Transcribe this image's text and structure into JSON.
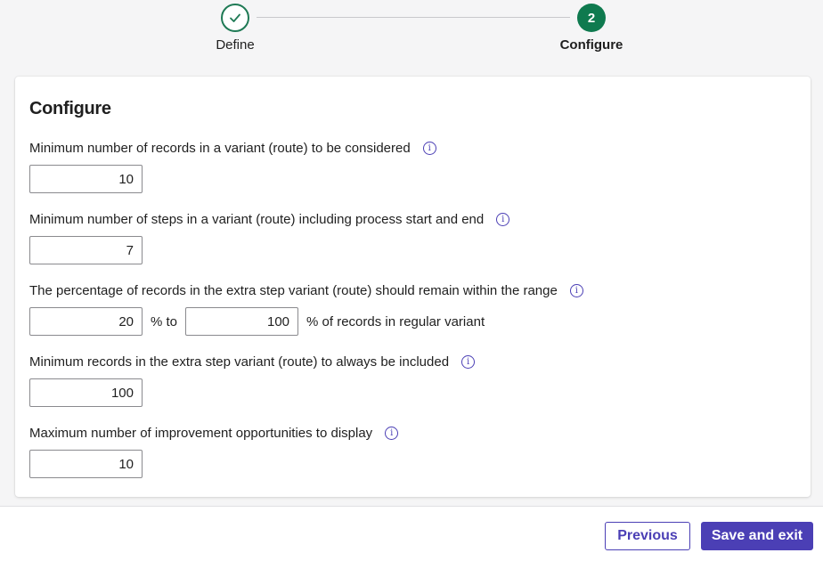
{
  "stepper": {
    "steps": [
      {
        "label": "Define",
        "state": "complete",
        "number": ""
      },
      {
        "label": "Configure",
        "state": "active",
        "number": "2"
      }
    ]
  },
  "card": {
    "title": "Configure",
    "fields": {
      "min_records": {
        "label": "Minimum number of records in a variant (route) to be considered",
        "value": "10"
      },
      "min_steps": {
        "label": "Minimum number of steps in a variant (route) including process start and end",
        "value": "7"
      },
      "percentage": {
        "label": "The percentage of records in the extra step variant (route) should remain within the range",
        "from_value": "20",
        "to_text": "% to",
        "to_value": "100",
        "suffix": "% of records in regular variant"
      },
      "min_extra_records": {
        "label": "Minimum records in the extra step variant (route) to always be included",
        "value": "100"
      },
      "max_opportunities": {
        "label": "Maximum number of improvement opportunities to display",
        "value": "10"
      }
    }
  },
  "footer": {
    "previous_label": "Previous",
    "save_label": "Save and exit"
  },
  "colors": {
    "accent": "#4b3fb5",
    "step_green": "#0f7a4f"
  },
  "icons": {
    "info": "info-icon",
    "check": "checkmark-icon"
  }
}
